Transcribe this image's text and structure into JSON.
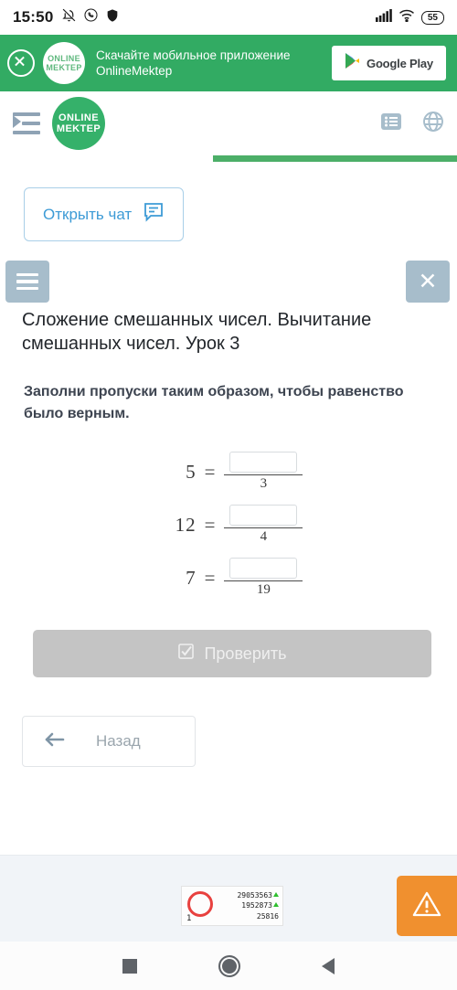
{
  "status_bar": {
    "time": "15:50",
    "icons": [
      "mute-icon",
      "whatsapp-icon",
      "shield-icon"
    ],
    "signal_icon": "signal-bars-icon",
    "wifi_icon": "wifi-icon",
    "battery_level": "55"
  },
  "app_banner": {
    "close_label": "x",
    "logo_line1": "ONLINE",
    "logo_line2": "MEKTEP",
    "text": "Скачайте мобильное приложение OnlineMektep",
    "store_button": "Google Play",
    "background_color": "#32ab63"
  },
  "site_header": {
    "menu_icon": "indent-menu-icon",
    "logo_line1": "ONLINE",
    "logo_line2": "MEKTEP",
    "logo_color": "#35b16a",
    "list_icon": "list-icon",
    "globe_icon": "globe-icon"
  },
  "progress": {
    "color": "#4caf68",
    "value": "53"
  },
  "chat": {
    "label": "Открыть чат",
    "icon": "chat-bubble-icon",
    "color": "#3d9bd6"
  },
  "lesson": {
    "menu_icon": "hamburger-icon",
    "close_icon": "close-icon",
    "title": "Сложение смешанных чисел. Вычитание смешанных чисел. Урок 3"
  },
  "task": {
    "instruction": "Заполни пропуски таким образом, чтобы равенство было верным.",
    "equations": [
      {
        "left": "5",
        "equals": "=",
        "numerator_value": "",
        "denominator": "3"
      },
      {
        "left": "12",
        "equals": "=",
        "numerator_value": "",
        "denominator": "4"
      },
      {
        "left": "7",
        "equals": "=",
        "numerator_value": "",
        "denominator": "19"
      }
    ]
  },
  "actions": {
    "check_label": "Проверить",
    "check_icon": "checkbox-icon",
    "check_disabled_color": "#c4c4c4",
    "back_label": "Назад",
    "back_icon": "arrow-left-icon"
  },
  "footer": {
    "counter": {
      "index": "1",
      "row1": "29053563",
      "row2": "1952873",
      "row3": "25816",
      "ring_color": "#e8413f",
      "trend_color": "#2fbf2f"
    },
    "warning_icon": "warning-triangle-icon",
    "warning_color": "#f0902f"
  },
  "nav_bar": {
    "recents_icon": "square-recents-icon",
    "home_icon": "circle-home-icon",
    "back_icon": "triangle-back-icon"
  }
}
